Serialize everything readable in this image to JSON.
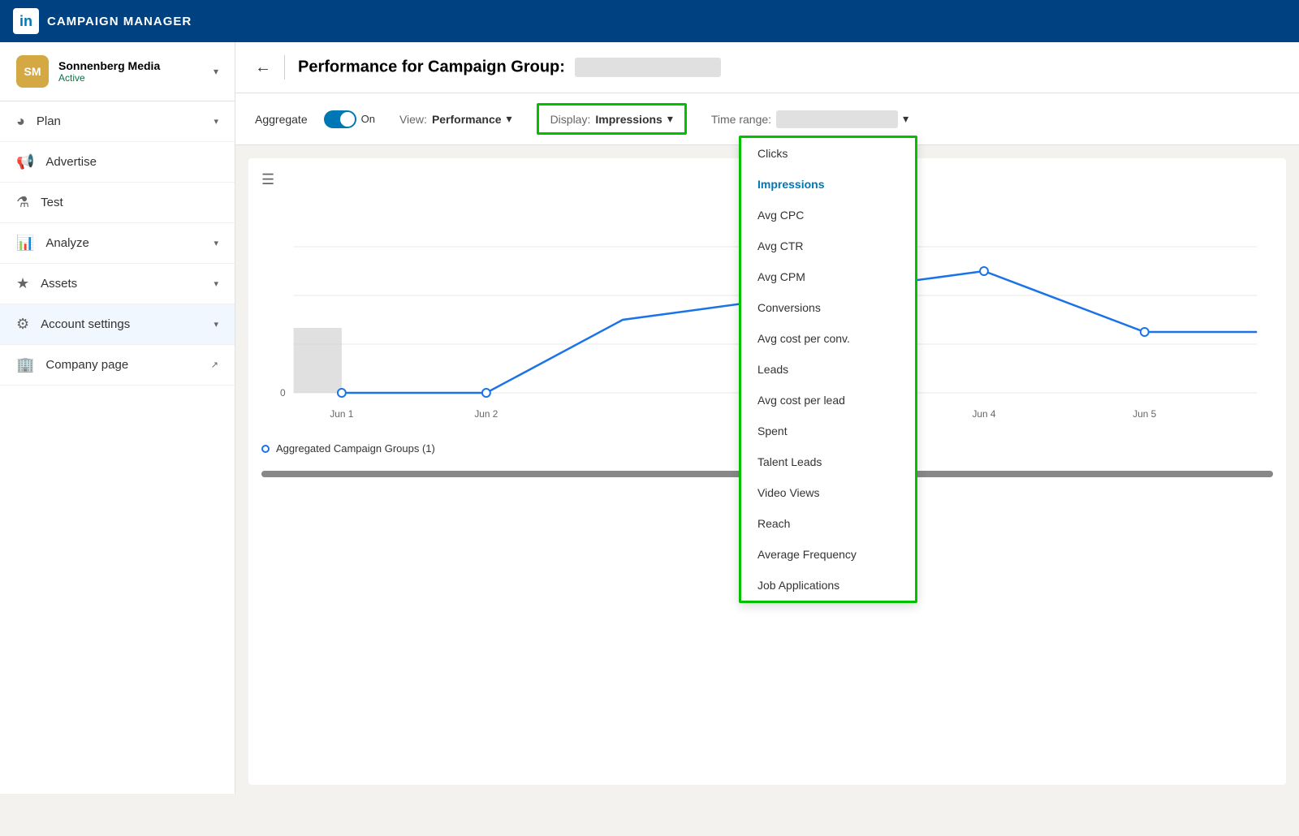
{
  "topNav": {
    "logo_text": "in",
    "title": "CAMPAIGN MANAGER"
  },
  "sidebar": {
    "account": {
      "name": "Sonnenberg Media",
      "status": "Active",
      "initials": "SM"
    },
    "items": [
      {
        "id": "plan",
        "label": "Plan",
        "has_chevron": true,
        "icon": "🧭"
      },
      {
        "id": "advertise",
        "label": "Advertise",
        "has_chevron": false,
        "icon": "📢"
      },
      {
        "id": "test",
        "label": "Test",
        "has_chevron": false,
        "icon": "🧪"
      },
      {
        "id": "analyze",
        "label": "Analyze",
        "has_chevron": true,
        "icon": "📊"
      },
      {
        "id": "assets",
        "label": "Assets",
        "has_chevron": true,
        "icon": "🎨"
      },
      {
        "id": "account-settings",
        "label": "Account settings",
        "has_chevron": true,
        "icon": "⚙️"
      },
      {
        "id": "company-page",
        "label": "Company page",
        "has_chevron": false,
        "icon": "🏢",
        "external": true
      }
    ]
  },
  "pageHeader": {
    "title": "Performance for Campaign Group:",
    "campaign_name_placeholder": ""
  },
  "toolbar": {
    "aggregate_label": "Aggregate",
    "aggregate_on": "On",
    "view_label": "View:",
    "view_value": "Performance",
    "display_label": "Display:",
    "display_value": "Impressions",
    "time_range_label": "Time range:"
  },
  "dropdown": {
    "items": [
      {
        "id": "clicks",
        "label": "Clicks",
        "active": false
      },
      {
        "id": "impressions",
        "label": "Impressions",
        "active": true
      },
      {
        "id": "avg-cpc",
        "label": "Avg CPC",
        "active": false
      },
      {
        "id": "avg-ctr",
        "label": "Avg CTR",
        "active": false
      },
      {
        "id": "avg-cpm",
        "label": "Avg CPM",
        "active": false
      },
      {
        "id": "conversions",
        "label": "Conversions",
        "active": false
      },
      {
        "id": "avg-cost-conv",
        "label": "Avg cost per conv.",
        "active": false
      },
      {
        "id": "leads",
        "label": "Leads",
        "active": false
      },
      {
        "id": "avg-cost-lead",
        "label": "Avg cost per lead",
        "active": false
      },
      {
        "id": "spent",
        "label": "Spent",
        "active": false
      },
      {
        "id": "talent-leads",
        "label": "Talent Leads",
        "active": false
      },
      {
        "id": "video-views",
        "label": "Video Views",
        "active": false
      },
      {
        "id": "reach",
        "label": "Reach",
        "active": false
      },
      {
        "id": "average-frequency",
        "label": "Average Frequency",
        "active": false
      },
      {
        "id": "job-applications",
        "label": "Job Applications",
        "active": false
      }
    ]
  },
  "chart": {
    "y_axis_zero": "0",
    "x_labels": [
      "Jun 1",
      "Jun 2",
      "Jun 4",
      "Jun 5"
    ],
    "legend_label": "Aggregated Campaign Groups (1)"
  }
}
